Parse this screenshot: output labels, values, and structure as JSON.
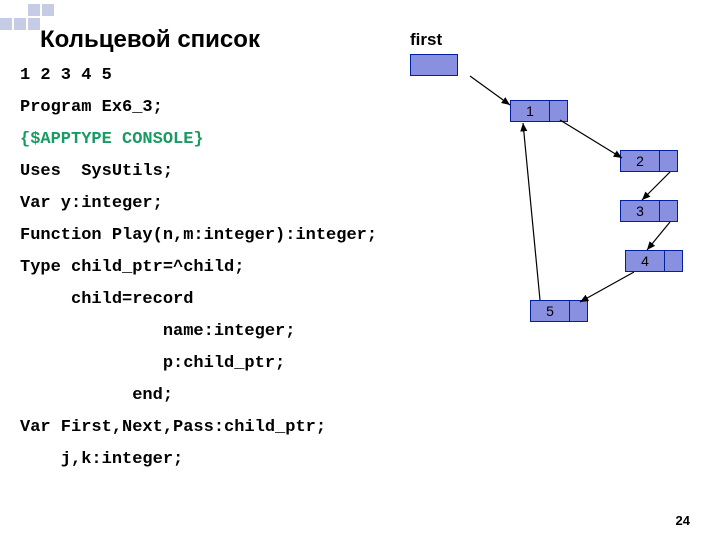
{
  "title": "Кольцевой список",
  "code_lines": [
    {
      "text": "1 2 3 4 5",
      "class": ""
    },
    {
      "text": "Program Ex6_3;",
      "class": ""
    },
    {
      "text": "{$APPTYPE CONSOLE}",
      "class": "green"
    },
    {
      "text": "Uses  SysUtils;",
      "class": ""
    },
    {
      "text": "Var y:integer;",
      "class": ""
    },
    {
      "text": "Function Play(n,m:integer):integer;",
      "class": ""
    },
    {
      "text": "Type child_ptr=^child;",
      "class": ""
    },
    {
      "text": "     child=record",
      "class": ""
    },
    {
      "text": "              name:integer;",
      "class": ""
    },
    {
      "text": "              p:child_ptr;",
      "class": ""
    },
    {
      "text": "           end;",
      "class": ""
    },
    {
      "text": "Var First,Next,Pass:child_ptr;",
      "class": ""
    },
    {
      "text": "    j,k:integer;",
      "class": ""
    }
  ],
  "diagram": {
    "first_label": "first",
    "nodes": [
      "1",
      "2",
      "3",
      "4",
      "5"
    ]
  },
  "page_number": "24"
}
